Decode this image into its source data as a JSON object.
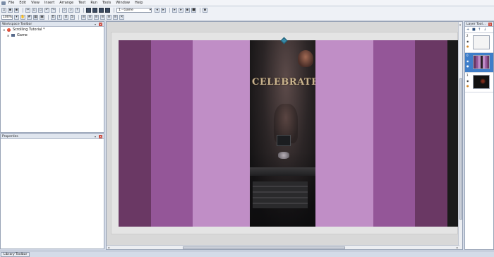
{
  "menu": {
    "items": [
      "File",
      "Edit",
      "View",
      "Insert",
      "Arrange",
      "Text",
      "Run",
      "Tools",
      "Window",
      "Help"
    ]
  },
  "toolbar": {
    "layout_select": "1 - Game",
    "zoom_select": "100%"
  },
  "workspace": {
    "title": "Workspace Toolbar",
    "app_name": "Scrolling Tutorial *",
    "frame_name": "Game"
  },
  "properties": {
    "title": "Properties"
  },
  "editor": {
    "stripes": [
      {
        "color": "#6a3864"
      },
      {
        "color": "#945698"
      },
      {
        "color": "#c08ec6"
      },
      {
        "color": "#gameimg"
      },
      {
        "color": "#c08ec6"
      },
      {
        "color": "#945698"
      },
      {
        "color": "#6a3864"
      }
    ],
    "game_text": "CELEBRATE!"
  },
  "layers": {
    "title": "Layer Tool...",
    "rows": [
      {
        "num": "2",
        "selected": false,
        "thumb": "blank"
      },
      {
        "num": "0",
        "selected": true,
        "thumb": "stripes"
      },
      {
        "num": "1",
        "selected": false,
        "thumb": "dark"
      }
    ]
  },
  "statusbar": {
    "tab_label": "Library Toolbar"
  },
  "colors": {
    "accent": "#3f7ec9",
    "stripe_dark": "#6a3864",
    "stripe_mid": "#945698",
    "stripe_light": "#c08ec6"
  }
}
